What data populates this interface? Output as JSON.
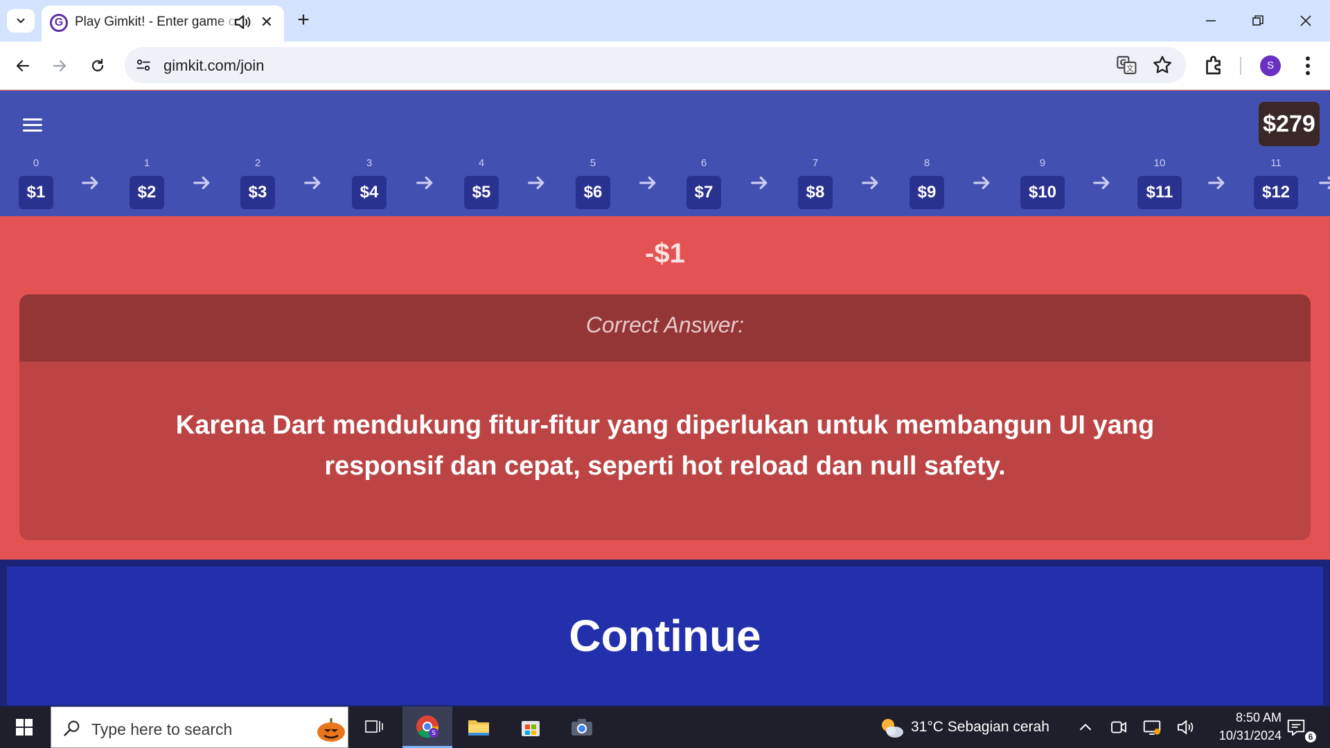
{
  "browser": {
    "tab_title": "Play Gimkit! - Enter game code",
    "url": "gimkit.com/join",
    "profile_initial": "S",
    "favicon_letter": "G"
  },
  "game": {
    "balance": "$279",
    "steps": [
      {
        "index": "0",
        "value": "$1"
      },
      {
        "index": "1",
        "value": "$2"
      },
      {
        "index": "2",
        "value": "$3"
      },
      {
        "index": "3",
        "value": "$4"
      },
      {
        "index": "4",
        "value": "$5"
      },
      {
        "index": "5",
        "value": "$6"
      },
      {
        "index": "6",
        "value": "$7"
      },
      {
        "index": "7",
        "value": "$8"
      },
      {
        "index": "8",
        "value": "$9"
      },
      {
        "index": "9",
        "value": "$10"
      },
      {
        "index": "10",
        "value": "$11"
      },
      {
        "index": "11",
        "value": "$12"
      }
    ],
    "delta": "-$1",
    "answer_heading": "Correct Answer:",
    "answer_text": "Karena Dart mendukung fitur-fitur yang diperlukan untuk membangun UI yang responsif dan cepat, seperti hot reload dan null safety.",
    "continue_label": "Continue"
  },
  "taskbar": {
    "search_placeholder": "Type here to search",
    "weather": "31°C  Sebagian cerah",
    "time": "8:50 AM",
    "date": "10/31/2024",
    "notification_count": "6"
  },
  "colors": {
    "header_bg": "#4250b2",
    "result_bg": "#e35353",
    "continue_bg": "#2330ab",
    "balance_bg": "#3a2828"
  }
}
